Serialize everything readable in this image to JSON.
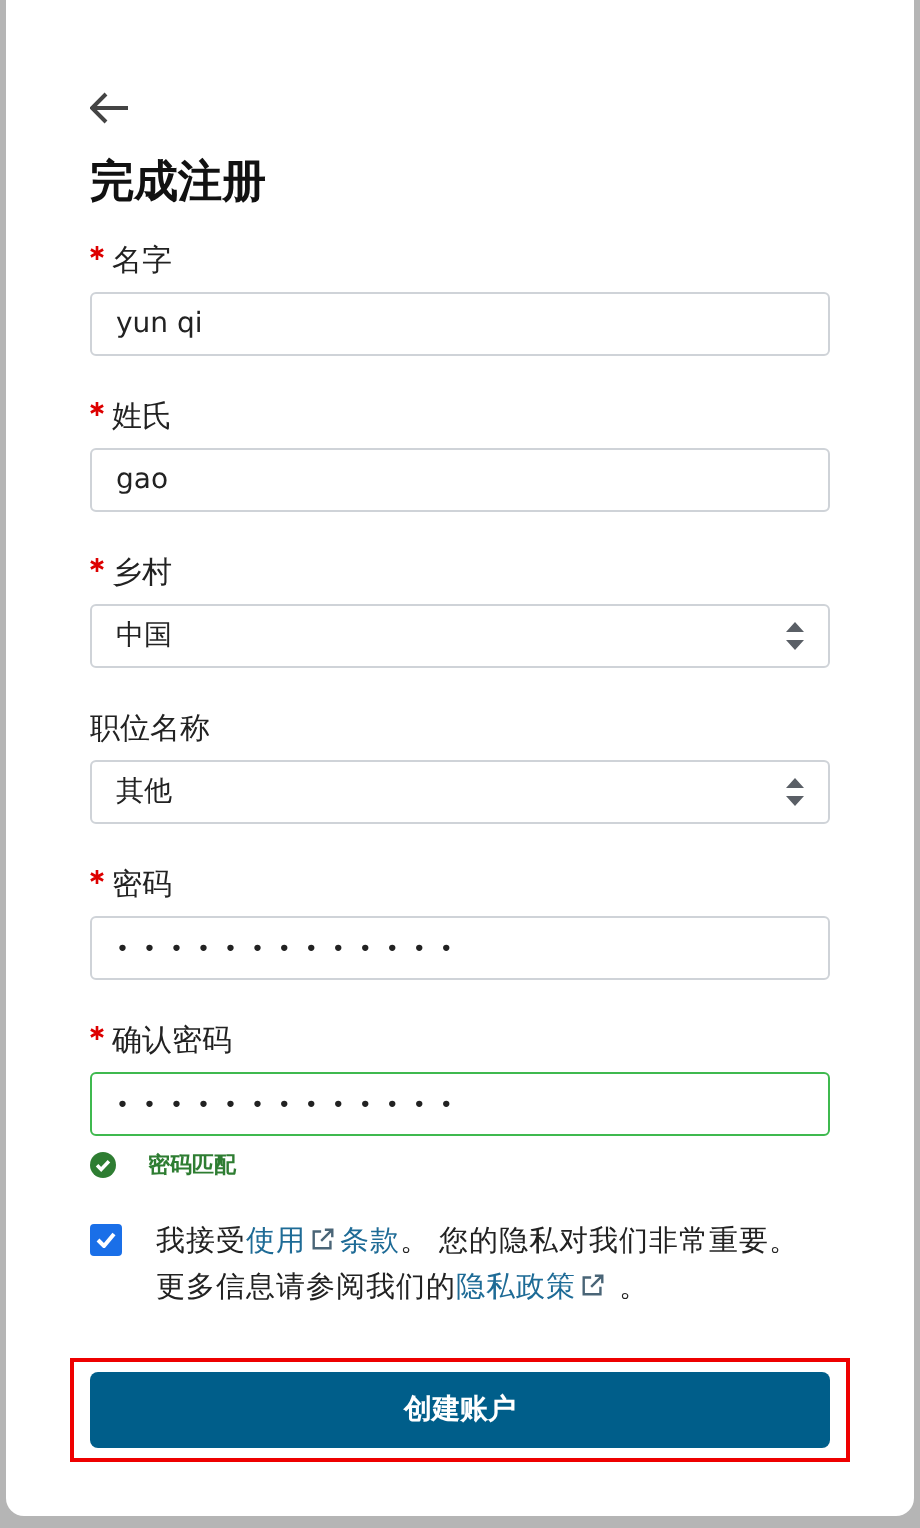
{
  "title": "完成注册",
  "fields": [
    {
      "kind": "text",
      "label": "名字",
      "required": true,
      "value": "yun qi",
      "valid": false
    },
    {
      "kind": "text",
      "label": "姓氏",
      "required": true,
      "value": "gao",
      "valid": false
    },
    {
      "kind": "select",
      "label": "乡村",
      "required": true,
      "value": "中国",
      "valid": false
    },
    {
      "kind": "select",
      "label": "职位名称",
      "required": false,
      "value": "其他",
      "valid": false
    },
    {
      "kind": "password",
      "label": "密码",
      "required": true,
      "value": "•••••••••••••",
      "valid": false
    },
    {
      "kind": "password",
      "label": "确认密码",
      "required": true,
      "value": "•••••••••••••",
      "valid": true
    }
  ],
  "match_message": "密码匹配",
  "consent": {
    "checked": true,
    "parts": [
      {
        "kind": "text",
        "text": "我接受"
      },
      {
        "kind": "link",
        "text": "使用"
      },
      {
        "kind": "icon"
      },
      {
        "kind": "link",
        "text": "条款"
      },
      {
        "kind": "text",
        "text": "。 您的隐私对我们非常重要。更多信息请参阅我们的"
      },
      {
        "kind": "link",
        "text": "隐私政策"
      },
      {
        "kind": "icon"
      },
      {
        "kind": "text",
        "text": " 。"
      }
    ]
  },
  "submit": {
    "label": "创建账户",
    "highlighted": true
  }
}
